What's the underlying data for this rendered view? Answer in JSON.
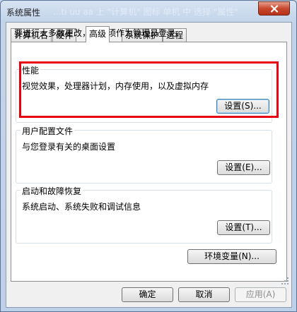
{
  "window": {
    "title": "系统属性",
    "watermark": "...ti uu aa 上 \"计算机\" 图标 单机 中 选择 \"属性\""
  },
  "tabs": [
    {
      "label": "计算机名",
      "active": false
    },
    {
      "label": "硬件",
      "active": false
    },
    {
      "label": "高级",
      "active": true
    },
    {
      "label": "系统保护",
      "active": false
    },
    {
      "label": "远程",
      "active": false
    }
  ],
  "advanced": {
    "admin_note": "要进行大多数更改，您必须作为管理员登录。",
    "performance": {
      "title": "性能",
      "description": "视觉效果，处理器计划，内存使用，以及虚拟内存",
      "button": "设置(S)..."
    },
    "user_profiles": {
      "title": "用户配置文件",
      "description": "与您登录有关的桌面设置",
      "button": "设置(E)..."
    },
    "startup_recovery": {
      "title": "启动和故障恢复",
      "description": "系统启动、系统失败和调试信息",
      "button": "设置(T)..."
    },
    "env_vars_button": "环境变量(N)..."
  },
  "footer": {
    "ok": "确定",
    "cancel": "取消",
    "apply": "应用(A)"
  },
  "colors": {
    "highlight": "#e60012",
    "close_button": "#c7492c"
  }
}
